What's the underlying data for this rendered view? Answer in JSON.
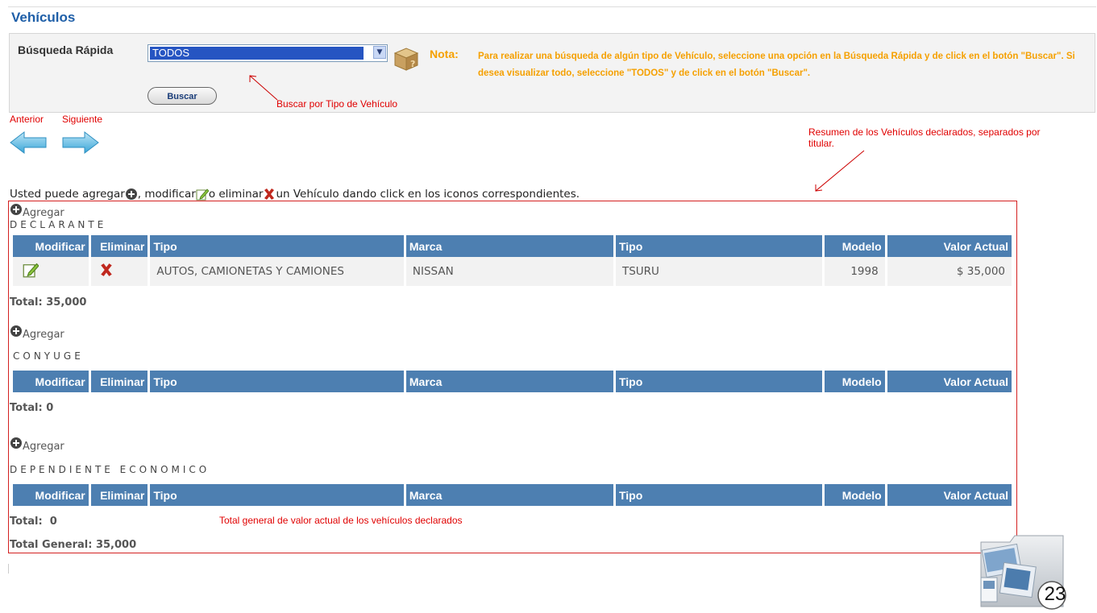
{
  "page": {
    "title": "Vehículos",
    "search": {
      "label": "Búsqueda Rápida",
      "selected": "TODOS",
      "button": "Buscar",
      "note_label": "Nota:",
      "note_text": "Para realizar una búsqueda de algún tipo de Vehículo, seleccione una opción en la Búsqueda Rápida y de click en el botón \"Buscar\". Si desea visualizar todo, seleccione \"TODOS\" y de click en el botón \"Buscar\"."
    },
    "nav": {
      "prev_label": "Anterior",
      "next_label": "Siguiente"
    },
    "instructions": {
      "part1": "Usted puede agregar",
      "part2": ", modificar",
      "part3": " o eliminar",
      "part4": " un Vehículo dando click en los iconos correspondientes."
    },
    "agregar_label": "Agregar",
    "columns": [
      "Modificar",
      "Eliminar",
      "Tipo",
      "Marca",
      "Tipo",
      "Modelo",
      "Valor Actual"
    ],
    "sections": [
      {
        "title": "DECLARANTE",
        "rows": [
          {
            "tipo": "AUTOS, CAMIONETAS Y CAMIONES",
            "marca": "NISSAN",
            "tipo2": "TSURU",
            "modelo": "1998",
            "valor": "$ 35,000"
          }
        ],
        "total": "Total: 35,000"
      },
      {
        "title": "CONYUGE",
        "rows": [],
        "total": "Total: 0"
      },
      {
        "title": "DEPENDIENTE ECONOMICO",
        "rows": [],
        "total": "Total:  0"
      }
    ],
    "total_general": "Total General: 35,000"
  },
  "annotations": {
    "buscar_tipo": "Buscar por Tipo de Vehículo",
    "resumen": "Resumen de los Vehículos declarados, separados por titular.",
    "total_general_note": "Total general de valor actual de los vehículos declarados"
  },
  "slide_number": "23",
  "colors": {
    "header_blue": "#4d7fb1",
    "title_blue": "#1f5fa8",
    "note_orange": "#f5a000",
    "annotation_red": "#e00000"
  }
}
